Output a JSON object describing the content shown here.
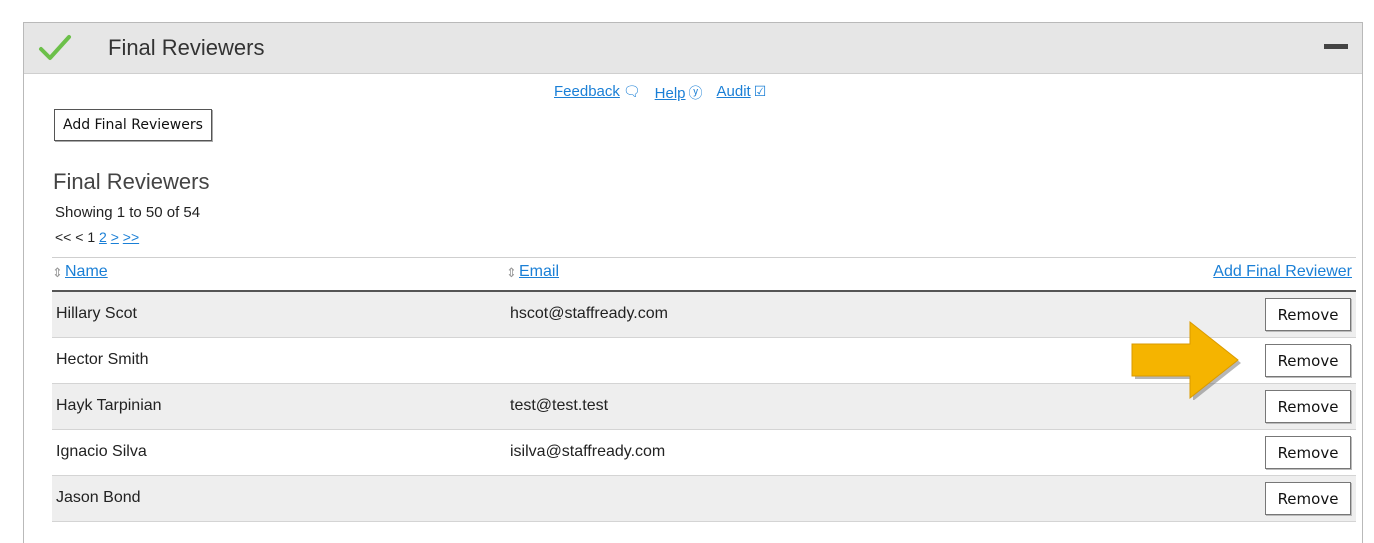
{
  "panel": {
    "title": "Final Reviewers"
  },
  "links": {
    "feedback": "Feedback",
    "help": "Help",
    "audit": "Audit"
  },
  "add_button_label": "Add Final Reviewers",
  "section": {
    "title": "Final Reviewers",
    "showing": "Showing 1 to 50 of 54"
  },
  "pager": {
    "first": "<<",
    "prev": "<",
    "current": "1",
    "page2": "2",
    "next": ">",
    "last": ">>"
  },
  "table": {
    "columns": {
      "name": "Name",
      "email": "Email",
      "action": "Add Final Reviewer"
    },
    "rows": [
      {
        "name": "Hillary Scot",
        "email": "hscot@staffready.com",
        "action": "Remove"
      },
      {
        "name": "Hector Smith",
        "email": "",
        "action": "Remove"
      },
      {
        "name": "Hayk Tarpinian",
        "email": "test@test.test",
        "action": "Remove"
      },
      {
        "name": "Ignacio Silva",
        "email": "isilva@staffready.com",
        "action": "Remove"
      },
      {
        "name": "Jason Bond",
        "email": "",
        "action": "Remove"
      }
    ]
  },
  "colors": {
    "link": "#1a7fd6",
    "check": "#6cc04a",
    "arrow": "#f5b400",
    "header_bg": "#e6e6e6",
    "row_alt_bg": "#eeeeee"
  },
  "icons": {
    "status": "check-icon",
    "collapse": "minus-icon",
    "feedback": "speech-bubble-icon",
    "help": "question-circle-icon",
    "audit": "clipboard-check-icon",
    "sort": "sort-icon",
    "annotation": "arrow-right-icon"
  }
}
